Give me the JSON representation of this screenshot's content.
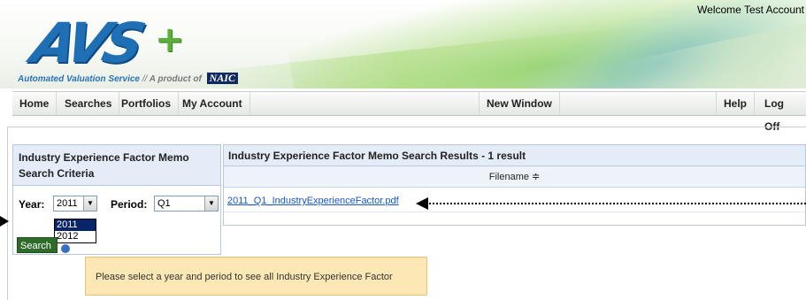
{
  "header": {
    "logo_text": "AVS",
    "logo_plus": "+",
    "tagline_service": "Automated Valuation Service",
    "tagline_separator": "//",
    "tagline_product": "A product of",
    "tagline_naic": "NAIC",
    "welcome": "Welcome Test Account"
  },
  "nav": {
    "home": "Home",
    "searches": "Searches",
    "portfolios": "Portfolios",
    "my_account": "My Account",
    "new_window": "New Window",
    "help": "Help",
    "log_off": "Log Off"
  },
  "criteria": {
    "title": "Industry Experience Factor Memo Search Criteria",
    "year_label": "Year:",
    "year_value": "2011",
    "year_options": [
      "2011",
      "2012"
    ],
    "period_label": "Period:",
    "period_value": "Q1",
    "search_button": "Search"
  },
  "results": {
    "title": "Industry Experience Factor Memo Search Results - 1 result",
    "column_filename": "Filename ≑",
    "rows": [
      {
        "filename": "2011_Q1_IndustryExperienceFactor.pdf"
      }
    ]
  },
  "message": {
    "text": "Please select a year and period to see all Industry Experience Factor Memos."
  },
  "colors": {
    "brand_blue": "#1f6fb5",
    "brand_green": "#5bb03a",
    "panel_header": "#e3ecf7",
    "search_button": "#2f6b2a",
    "message_bg": "#fde7b4",
    "link": "#1a56c4"
  }
}
